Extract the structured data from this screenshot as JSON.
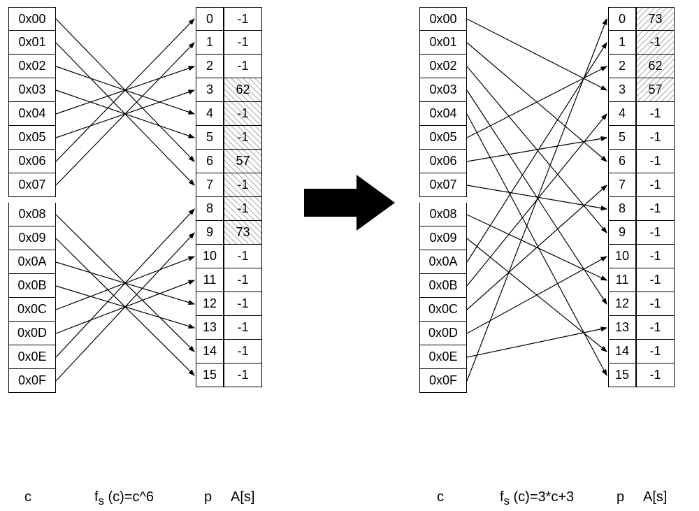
{
  "chart_data": {
    "type": "table",
    "title": "Hash function remapping diagram",
    "left": {
      "function": "f_s (c)=c^6",
      "c": [
        "0x00",
        "0x01",
        "0x02",
        "0x03",
        "0x04",
        "0x05",
        "0x06",
        "0x07",
        "0x08",
        "0x09",
        "0x0A",
        "0x0B",
        "0x0C",
        "0x0D",
        "0x0E",
        "0x0F"
      ],
      "p": [
        0,
        1,
        2,
        3,
        4,
        5,
        6,
        7,
        8,
        9,
        10,
        11,
        12,
        13,
        14,
        15
      ],
      "A": [
        -1,
        -1,
        -1,
        62,
        -1,
        -1,
        57,
        -1,
        -1,
        73,
        -1,
        -1,
        -1,
        -1,
        -1,
        -1
      ],
      "hatched_indices": [
        3,
        4,
        5,
        6,
        7,
        8,
        9
      ],
      "mappings": [
        [
          0,
          6
        ],
        [
          1,
          7
        ],
        [
          2,
          4
        ],
        [
          3,
          5
        ],
        [
          4,
          2
        ],
        [
          5,
          3
        ],
        [
          6,
          0
        ],
        [
          7,
          1
        ],
        [
          8,
          14
        ],
        [
          9,
          15
        ],
        [
          10,
          12
        ],
        [
          11,
          13
        ],
        [
          12,
          10
        ],
        [
          13,
          11
        ],
        [
          14,
          8
        ],
        [
          15,
          9
        ]
      ]
    },
    "right": {
      "function": "f_s (c)=3*c+3",
      "c": [
        "0x00",
        "0x01",
        "0x02",
        "0x03",
        "0x04",
        "0x05",
        "0x06",
        "0x07",
        "0x08",
        "0x09",
        "0x0A",
        "0x0B",
        "0x0C",
        "0x0D",
        "0x0E",
        "0x0F"
      ],
      "p": [
        0,
        1,
        2,
        3,
        4,
        5,
        6,
        7,
        8,
        9,
        10,
        11,
        12,
        13,
        14,
        15
      ],
      "A": [
        73,
        -1,
        62,
        57,
        -1,
        -1,
        -1,
        -1,
        -1,
        -1,
        -1,
        -1,
        -1,
        -1,
        -1,
        -1
      ],
      "hatched_indices": [
        0,
        1,
        2,
        3
      ],
      "mappings": [
        [
          0,
          3
        ],
        [
          1,
          6
        ],
        [
          2,
          9
        ],
        [
          3,
          12
        ],
        [
          4,
          15
        ],
        [
          5,
          2
        ],
        [
          6,
          5
        ],
        [
          7,
          8
        ],
        [
          8,
          11
        ],
        [
          9,
          14
        ],
        [
          10,
          1
        ],
        [
          11,
          4
        ],
        [
          12,
          7
        ],
        [
          13,
          10
        ],
        [
          14,
          13
        ],
        [
          15,
          0
        ]
      ]
    },
    "labels": {
      "c": "c",
      "p": "p",
      "A": "A[s]"
    }
  }
}
